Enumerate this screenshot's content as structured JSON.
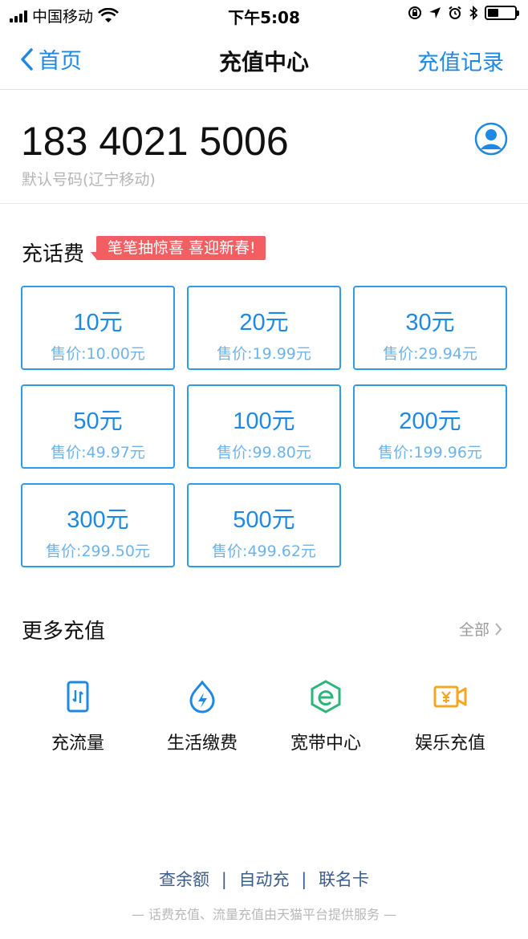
{
  "status_bar": {
    "carrier": "中国移动",
    "time": "下午5:08"
  },
  "nav": {
    "back_label": "首页",
    "title": "充值中心",
    "right_label": "充值记录"
  },
  "account": {
    "phone_number": "183 4021 5006",
    "subtitle": "默认号码(辽宁移动)"
  },
  "recharge": {
    "title": "充话费",
    "promo": "笔笔抽惊喜 喜迎新春!",
    "options": [
      {
        "amount": "10元",
        "price": "售价:10.00元"
      },
      {
        "amount": "20元",
        "price": "售价:19.99元"
      },
      {
        "amount": "30元",
        "price": "售价:29.94元"
      },
      {
        "amount": "50元",
        "price": "售价:49.97元"
      },
      {
        "amount": "100元",
        "price": "售价:99.80元"
      },
      {
        "amount": "200元",
        "price": "售价:199.96元"
      },
      {
        "amount": "300元",
        "price": "售价:299.50元"
      },
      {
        "amount": "500元",
        "price": "售价:499.62元"
      }
    ]
  },
  "more": {
    "title": "更多充值",
    "all_label": "全部",
    "services": [
      {
        "label": "充流量",
        "icon": "data-traffic-icon",
        "color": "#1e88e5"
      },
      {
        "label": "生活缴费",
        "icon": "utility-bill-icon",
        "color": "#1e88e5"
      },
      {
        "label": "宽带中心",
        "icon": "broadband-icon",
        "color": "#2bb57a"
      },
      {
        "label": "娱乐充值",
        "icon": "entertainment-icon",
        "color": "#f5a623"
      }
    ]
  },
  "footer": {
    "links": [
      "查余额",
      "自动充",
      "联名卡"
    ],
    "note": "— 话费充值、流量充值由天猫平台提供服务 —"
  },
  "colors": {
    "accent": "#1e88e5",
    "promo": "#f25e62"
  }
}
